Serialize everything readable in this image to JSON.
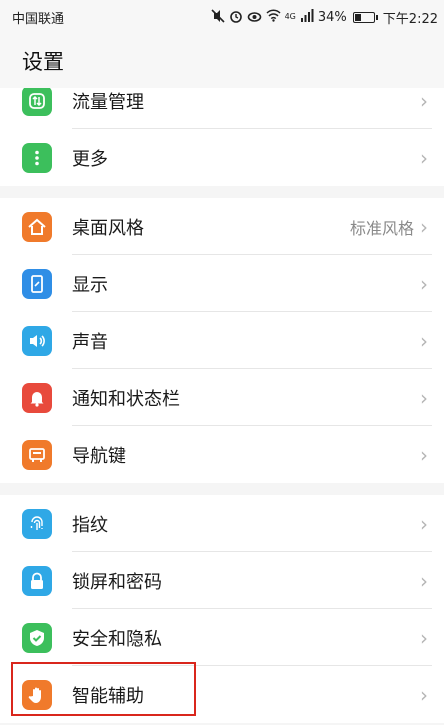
{
  "status_bar": {
    "carrier": "中国联通",
    "network_type": "4G",
    "battery_percent": "34%",
    "battery_level": 0.34,
    "time": "下午2:22",
    "icons": [
      "mute-icon",
      "alarm-icon",
      "eye-icon",
      "wifi-icon",
      "signal-icon",
      "battery-icon"
    ]
  },
  "header": {
    "title": "设置"
  },
  "groups": [
    {
      "items": [
        {
          "label": "流量管理",
          "icon": "data-usage-icon",
          "color": "#3cbf5c"
        },
        {
          "label": "更多",
          "icon": "more-icon",
          "color": "#3cbf5c"
        }
      ]
    },
    {
      "items": [
        {
          "label": "桌面风格",
          "value": "标准风格",
          "icon": "home-icon",
          "color": "#f07a2b"
        },
        {
          "label": "显示",
          "icon": "display-icon",
          "color": "#2f8ee6"
        },
        {
          "label": "声音",
          "icon": "sound-icon",
          "color": "#2fa8e6"
        },
        {
          "label": "通知和状态栏",
          "icon": "bell-icon",
          "color": "#e84a3c"
        },
        {
          "label": "导航键",
          "icon": "navigation-icon",
          "color": "#f07a2b"
        }
      ]
    },
    {
      "items": [
        {
          "label": "指纹",
          "icon": "fingerprint-icon",
          "color": "#2fa8e6"
        },
        {
          "label": "锁屏和密码",
          "icon": "lock-icon",
          "color": "#2fa8e6"
        },
        {
          "label": "安全和隐私",
          "icon": "shield-icon",
          "color": "#3cbf5c"
        },
        {
          "label": "智能辅助",
          "icon": "hand-icon",
          "color": "#f07a2b",
          "highlighted": true
        }
      ]
    }
  ],
  "chevron": "›"
}
